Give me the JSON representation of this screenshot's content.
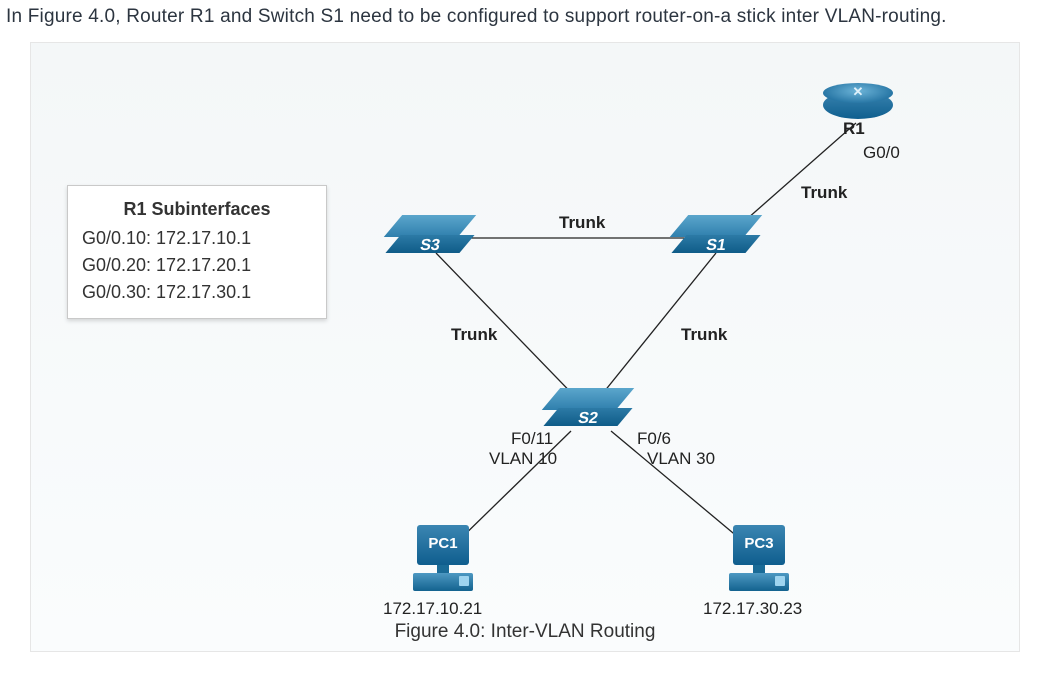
{
  "intro_text": "In Figure 4.0, Router R1 and Switch S1 need to be configured to support router-on-a stick inter VLAN-routing.",
  "figure_caption": "Figure 4.0: Inter-VLAN Routing",
  "config_box": {
    "title": "R1 Subinterfaces",
    "lines": [
      "G0/0.10: 172.17.10.1",
      "G0/0.20: 172.17.20.1",
      "G0/0.30: 172.17.30.1"
    ]
  },
  "devices": {
    "router": {
      "name": "R1",
      "interface": "G0/0"
    },
    "switches": {
      "s1": "S1",
      "s2": "S2",
      "s3": "S3"
    },
    "pcs": {
      "pc1": {
        "name": "PC1",
        "ip": "172.17.10.21"
      },
      "pc3": {
        "name": "PC3",
        "ip": "172.17.30.23"
      }
    }
  },
  "link_labels": {
    "s3_s1": "Trunk",
    "s1_r1": "Trunk",
    "s3_s2": "Trunk",
    "s1_s2": "Trunk",
    "s2_pc1_port": "F0/11",
    "s2_pc1_vlan": "VLAN 10",
    "s2_pc3_port": "F0/6",
    "s2_pc3_vlan": "VLAN 30"
  },
  "colors": {
    "device_fill": "#2f7fad",
    "text": "#222222"
  }
}
